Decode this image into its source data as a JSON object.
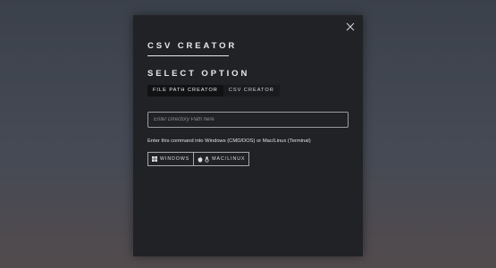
{
  "modal": {
    "title": "CSV CREATOR",
    "section_heading": "SELECT OPTION",
    "tabs": [
      {
        "label": "FILE PATH CREATOR",
        "active": true
      },
      {
        "label": "CSV CREATOR",
        "active": false
      }
    ],
    "path_input": {
      "placeholder": "Enter Directory Path here",
      "value": ""
    },
    "instruction": "Enter this command into Windows (CMD/DOS) or Mac/Linux (Terminal)",
    "os_buttons": [
      {
        "label": "WINDOWS",
        "icons": [
          "windows-icon"
        ]
      },
      {
        "label": "MAC/LINUX",
        "icons": [
          "apple-icon",
          "linux-icon"
        ]
      }
    ],
    "close_icon": "close-icon"
  },
  "colors": {
    "modal_bg": "#212226",
    "text": "#e9e9e9",
    "input_border": "#9b9ba0"
  }
}
